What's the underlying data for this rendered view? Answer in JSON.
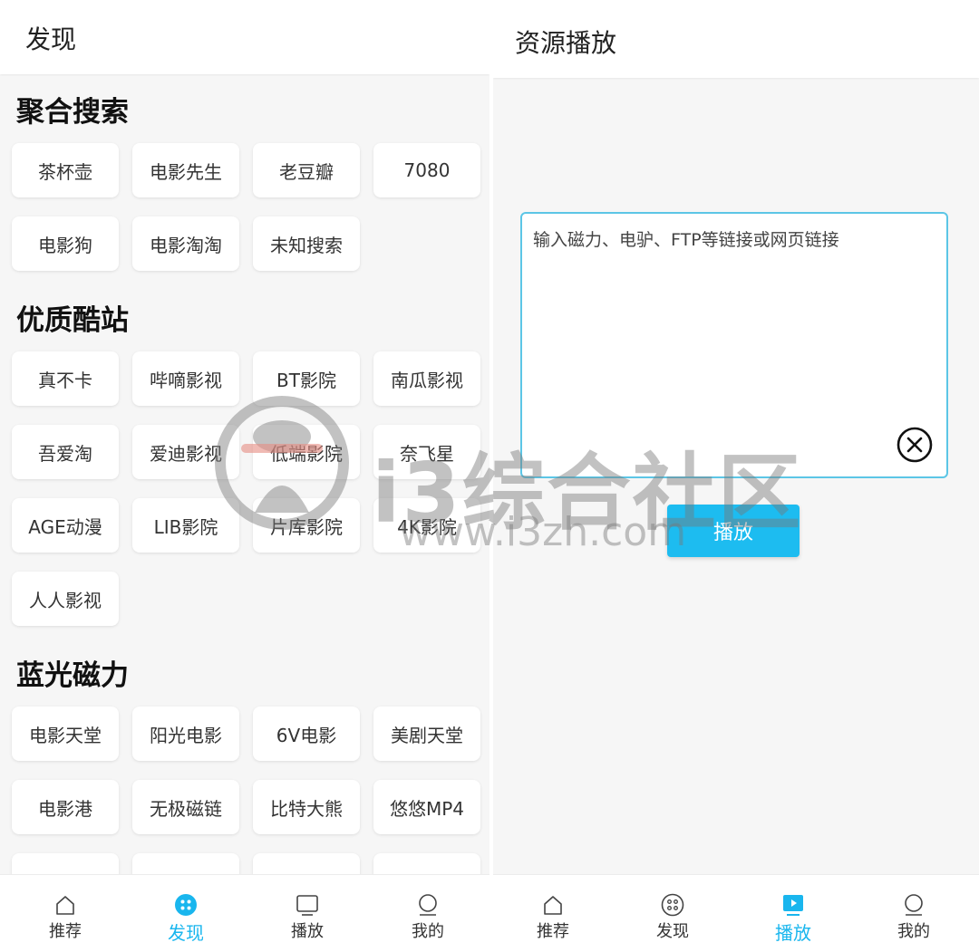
{
  "left": {
    "header": {
      "title": "发现"
    },
    "sections": [
      {
        "title": "聚合搜索",
        "items": [
          "茶杯壶",
          "电影先生",
          "老豆瓣",
          "7080",
          "电影狗",
          "电影淘淘",
          "未知搜索"
        ]
      },
      {
        "title": "优质酷站",
        "items": [
          "真不卡",
          "哔嘀影视",
          "BT影院",
          "南瓜影视",
          "吾爱淘",
          "爱迪影视",
          "低端影院",
          "奈飞星",
          "AGE动漫",
          "LIB影院",
          "片库影院",
          "4K影院",
          "人人影视"
        ]
      },
      {
        "title": "蓝光磁力",
        "items": [
          "电影天堂",
          "阳光电影",
          "6V电影",
          "美剧天堂",
          "电影港",
          "无极磁链",
          "比特大熊",
          "悠悠MP4"
        ]
      }
    ],
    "nav": [
      {
        "label": "推荐",
        "icon": "home-icon"
      },
      {
        "label": "发现",
        "icon": "discover-icon"
      },
      {
        "label": "播放",
        "icon": "play-icon"
      },
      {
        "label": "我的",
        "icon": "profile-icon"
      }
    ]
  },
  "right": {
    "header": {
      "title": "资源播放"
    },
    "input": {
      "placeholder": "输入磁力、电驴、FTP等链接或网页链接"
    },
    "play_label": "播放",
    "nav": [
      {
        "label": "推荐",
        "icon": "home-icon"
      },
      {
        "label": "发现",
        "icon": "discover-icon"
      },
      {
        "label": "播放",
        "icon": "play-icon"
      },
      {
        "label": "我的",
        "icon": "profile-icon"
      }
    ]
  },
  "watermark": {
    "text": "i3综合社区",
    "url": "www.i3zh.com"
  },
  "colors": {
    "accent": "#19b6ee",
    "button": "#1dbcf0",
    "input_border": "#5cc6e6",
    "background": "#f6f6f6"
  }
}
